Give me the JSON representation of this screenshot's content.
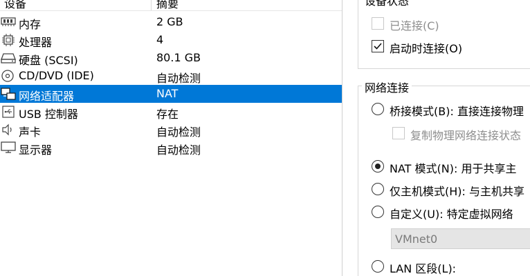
{
  "device_list": {
    "headers": {
      "device": "设备",
      "summary": "摘要"
    },
    "items": [
      {
        "icon": "memory-icon",
        "label": "内存",
        "value": "2 GB"
      },
      {
        "icon": "processor-icon",
        "label": "处理器",
        "value": "4"
      },
      {
        "icon": "hard-disk-icon",
        "label": "硬盘 (SCSI)",
        "value": "80.1 GB"
      },
      {
        "icon": "cd-dvd-icon",
        "label": "CD/DVD (IDE)",
        "value": "自动检测"
      },
      {
        "icon": "network-adapter-icon",
        "label": "网络适配器",
        "value": "NAT",
        "selected": true
      },
      {
        "icon": "usb-icon",
        "label": "USB 控制器",
        "value": "存在"
      },
      {
        "icon": "sound-card-icon",
        "label": "声卡",
        "value": "自动检测"
      },
      {
        "icon": "display-icon",
        "label": "显示器",
        "value": "自动检测"
      }
    ]
  },
  "settings": {
    "device_status": {
      "title": "设备状态",
      "connected": {
        "label": "已连接(C)",
        "checked": false,
        "disabled": true
      },
      "connect_on_start": {
        "label": "启动时连接(O)",
        "checked": true,
        "disabled": false
      }
    },
    "network_connection": {
      "title": "网络连接",
      "bridged": {
        "label": "桥接模式(B): 直接连接物理",
        "selected": false
      },
      "replicate": {
        "label": "复制物理网络连接状态",
        "checked": false,
        "disabled": true
      },
      "nat": {
        "label": "NAT 模式(N): 用于共享主",
        "selected": true
      },
      "host_only": {
        "label": "仅主机模式(H): 与主机共享",
        "selected": false
      },
      "custom": {
        "label": "自定义(U): 特定虚拟网络",
        "selected": false
      },
      "custom_network_value": "VMnet0",
      "lan_segment": {
        "label": "LAN 区段(L):",
        "selected": false
      }
    }
  },
  "colors": {
    "selection": "#0078d7",
    "disabled_text": "#8e8e8e",
    "dropdown_bg": "#e5e5e5"
  }
}
